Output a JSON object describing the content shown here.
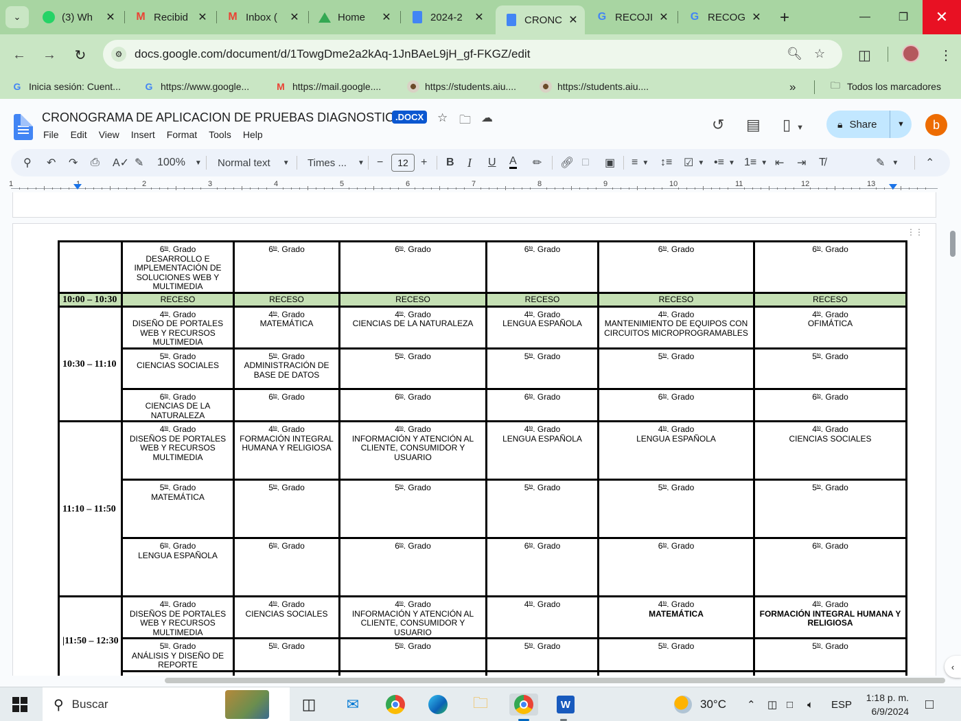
{
  "browser": {
    "tabs": [
      {
        "title": "(3) Wh",
        "icon": "whatsapp-icon",
        "color": "#25d366"
      },
      {
        "title": "Recibid",
        "icon": "gmail-icon",
        "color": "#ea4335"
      },
      {
        "title": "Inbox (",
        "icon": "gmail-icon",
        "color": "#ea4335"
      },
      {
        "title": "Home",
        "icon": "drive-icon",
        "color": "#fbbc04"
      },
      {
        "title": "2024-2",
        "icon": "docs-icon",
        "color": "#4285f4"
      },
      {
        "title": "CRONC",
        "icon": "docs-icon",
        "color": "#4285f4",
        "active": true
      },
      {
        "title": "RECOJI",
        "icon": "google-icon",
        "color": "#4285f4"
      },
      {
        "title": "RECOG",
        "icon": "google-icon",
        "color": "#4285f4"
      }
    ],
    "url": "docs.google.com/document/d/1TowgDme2a2kAq-1JnBAeL9jH_gf-FKGZ/edit",
    "bookmarks": [
      {
        "label": "Inicia sesión: Cuent...",
        "icon": "google-icon"
      },
      {
        "label": "https://www.google...",
        "icon": "google-icon"
      },
      {
        "label": "https://mail.google....",
        "icon": "gmail-icon"
      },
      {
        "label": "https://students.aiu....",
        "icon": "aiu-icon"
      },
      {
        "label": "https://students.aiu....",
        "icon": "aiu-icon"
      }
    ],
    "all_bookmarks": "Todos los marcadores"
  },
  "docs": {
    "title": "CRONOGRAMA DE APLICACION DE PRUEBAS DIAGNOSTICA",
    "badge": ".DOCX",
    "menu": [
      "File",
      "Edit",
      "View",
      "Insert",
      "Format",
      "Tools",
      "Help"
    ],
    "share": "Share",
    "account_initial": "b",
    "zoom": "100%",
    "style": "Normal text",
    "font": "Times ...",
    "font_size": "12",
    "ruler": [
      "1",
      "1",
      "2",
      "3",
      "4",
      "5",
      "6",
      "7",
      "8",
      "9",
      "10",
      "11",
      "12",
      "13"
    ]
  },
  "schedule": {
    "grado_sup": "to",
    "grado_word": ". Grado",
    "receso_time": "10:00 – 10:30",
    "receso_label": "RECESO",
    "blocks": [
      {
        "time": "",
        "rows": [
          [
            "DESARROLLO E IMPLEMENTACIÓN DE SOLUCIONES WEB Y MULTIMEDIA",
            "",
            "",
            "",
            "",
            ""
          ]
        ],
        "grades": [
          "6"
        ]
      },
      {
        "time": "10:30 – 11:10",
        "grades": [
          "4",
          "5",
          "6"
        ],
        "rows": [
          [
            "DISEÑO DE PORTALES WEB Y RECURSOS MULTIMEDIA",
            "MATEMÁTICA",
            "CIENCIAS DE LA NATURALEZA",
            "LENGUA ESPAÑOLA",
            "MANTENIMIENTO DE EQUIPOS CON CIRCUITOS MICROPROGRAMABLES",
            "OFIMÁTICA"
          ],
          [
            "CIENCIAS SOCIALES",
            "ADMINISTRACIÓN DE BASE DE DATOS",
            "",
            "",
            "",
            ""
          ],
          [
            "CIENCIAS DE LA NATURALEZA",
            "",
            "",
            "",
            "",
            ""
          ]
        ]
      },
      {
        "time": "11:10 – 11:50",
        "grades": [
          "4",
          "5",
          "6"
        ],
        "rows": [
          [
            "DISEÑOS  DE PORTALES WEB Y RECURSOS MULTIMEDIA",
            "FORMACIÓN INTEGRAL HUMANA Y RELIGIOSA",
            "INFORMACIÓN Y ATENCIÓN AL CLIENTE, CONSUMIDOR Y USUARIO",
            "LENGUA ESPAÑOLA",
            "LENGUA ESPAÑOLA",
            "CIENCIAS SOCIALES"
          ],
          [
            "MATEMÁTICA",
            "",
            "",
            "",
            "",
            ""
          ],
          [
            "LENGUA ESPAÑOLA",
            "",
            "",
            "",
            "",
            ""
          ]
        ]
      },
      {
        "time": "|11:50 – 12:30",
        "grades": [
          "4",
          "5",
          "6"
        ],
        "rows": [
          [
            "DISEÑOS DE PORTALES WEB Y RECURSOS MULTIMEDIA",
            "CIENCIAS SOCIALES",
            "INFORMACIÓN Y ATENCIÓN AL CLIENTE, CONSUMIDOR Y USUARIO",
            "",
            "MATEMÁTICA",
            "FORMACIÓN INTEGRAL HUMANA Y RELIGIOSA"
          ],
          [
            "ANÁLISIS Y DISEÑO DE REPORTE",
            "",
            "",
            "",
            "",
            ""
          ],
          [
            "",
            "",
            "",
            "",
            "",
            ""
          ]
        ]
      }
    ]
  },
  "taskbar": {
    "search_placeholder": "Buscar",
    "weather": "30°C",
    "lang": "ESP",
    "time": "1:18 p. m.",
    "date": "6/9/2024"
  }
}
